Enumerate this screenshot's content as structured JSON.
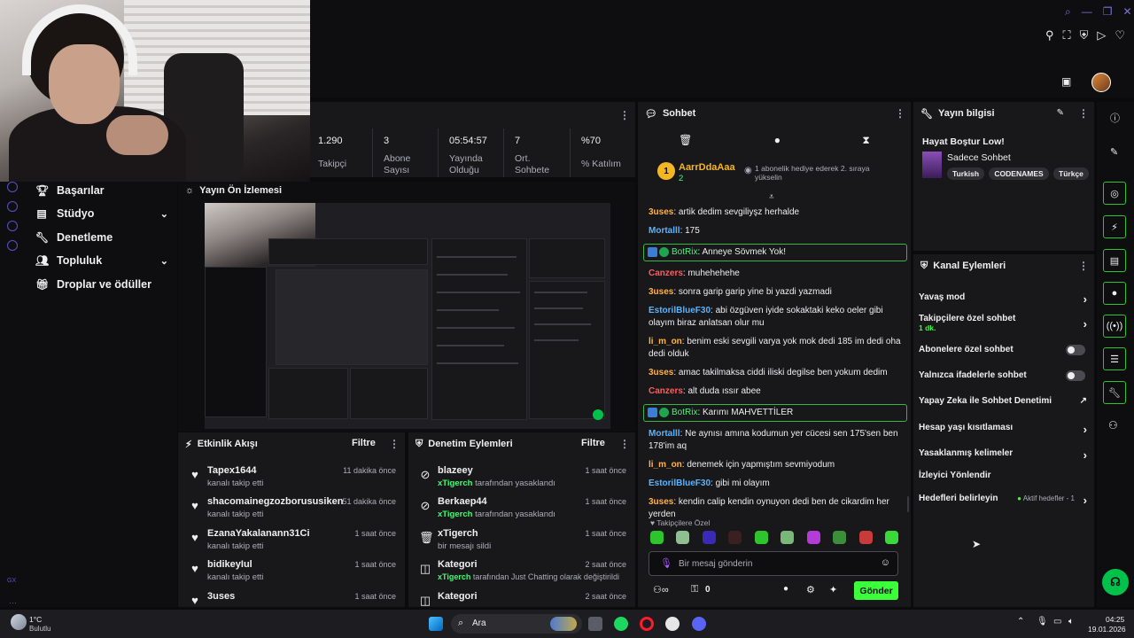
{
  "stats": [
    {
      "value": "1.290",
      "label": "Takipçi"
    },
    {
      "value": "3",
      "label": "Abone Sayısı"
    },
    {
      "value": "05:54:57",
      "label": "Yayında Olduğu"
    },
    {
      "value": "7",
      "label": "Ort. Sohbete"
    },
    {
      "value": "%70",
      "label": "% Katılım"
    }
  ],
  "nav": [
    {
      "label": "Başarılar",
      "icon": "trophy-icon"
    },
    {
      "label": "Stüdyo",
      "icon": "studio-icon"
    },
    {
      "label": "Denetleme",
      "icon": "wrench-icon"
    },
    {
      "label": "Topluluk",
      "icon": "community-icon"
    },
    {
      "label": "Droplar ve ödüller",
      "icon": "gift-icon"
    }
  ],
  "preview": {
    "title": "Yayın Ön İzlemesi"
  },
  "activity": {
    "title": "Etkinlik Akışı",
    "filter": "Filtre",
    "items": [
      {
        "name": "Tapex1644",
        "sub": "kanalı takip etti",
        "time": "11 dakika önce"
      },
      {
        "name": "shacomainegzozborususiken",
        "sub": "kanalı takip etti",
        "time": "51 dakika önce"
      },
      {
        "name": "EzanaYakalanann31Ci",
        "sub": "kanalı takip etti",
        "time": "1 saat önce"
      },
      {
        "name": "bidikeyIul",
        "sub": "kanalı takip etti",
        "time": "1 saat önce"
      },
      {
        "name": "3uses",
        "sub": "",
        "time": "1 saat önce"
      }
    ]
  },
  "modlog": {
    "title": "Denetim Eylemleri",
    "filter": "Filtre",
    "items": [
      {
        "name": "blazeey",
        "actor": "xTigerch",
        "rest": " tarafından yasaklandı",
        "time": "1 saat önce",
        "icon": "ban-icon"
      },
      {
        "name": "Berkaep44",
        "actor": "xTigerch",
        "rest": " tarafından yasaklandı",
        "time": "1 saat önce",
        "icon": "ban-icon"
      },
      {
        "name": "xTigerch",
        "actor": "",
        "rest": "bir mesajı sildi",
        "time": "1 saat önce",
        "icon": "trash-icon"
      },
      {
        "name": "Kategori",
        "actor": "xTigerch",
        "rest": " tarafından Just Chatting olarak değiştirildi",
        "time": "2 saat önce",
        "icon": "category-icon"
      },
      {
        "name": "Kategori",
        "actor": "",
        "rest": "",
        "time": "2 saat önce",
        "icon": "category-icon"
      }
    ]
  },
  "chat": {
    "title": "Sohbet",
    "hype_user": "AarrDdaAaa",
    "hype_rank": "1",
    "hype_count": "2",
    "hype_text": "1 abonelik hediye ederek 2. sıraya yükselin",
    "messages": [
      {
        "user": "3uses",
        "color": "#ffb347",
        "text": "artik dedim sevgiliyşz herhalde"
      },
      {
        "user": "Mortalll",
        "color": "#5ab4ff",
        "text": "175"
      },
      {
        "user": "BotRix",
        "color": "#3bff6f",
        "text": "Anneye Sövmek Yok!",
        "bot": true
      },
      {
        "user": "Canzers",
        "color": "#ff5c5c",
        "text": "muhehehehe"
      },
      {
        "user": "3uses",
        "color": "#ffb347",
        "text": "sonra garip garip yine bi yazdi yazmadi"
      },
      {
        "user": "EstorilBlueF30",
        "color": "#5ab4ff",
        "text": "abi özgüven iyide sokaktaki keko oeler gibi olayım biraz anlatsan olur mu"
      },
      {
        "user": "li_m_on",
        "color": "#ffb347",
        "text": "benim eski sevgili varya yok mok dedi 185 im dedi oha dedi olduk"
      },
      {
        "user": "3uses",
        "color": "#ffb347",
        "text": "amac takilmaksa ciddi iliski degilse ben yokum dedim"
      },
      {
        "user": "Canzers",
        "color": "#ff5c5c",
        "text": "alt duda ıssır abee"
      },
      {
        "user": "BotRix",
        "color": "#3bff6f",
        "text": "Karımı MAHVETTİLER",
        "bot": true
      },
      {
        "user": "Mortalll",
        "color": "#5ab4ff",
        "text": "Ne aynısı amına kodumun yer cücesi sen 175'sen ben 178'im aq"
      },
      {
        "user": "li_m_on",
        "color": "#ffb347",
        "text": "denemek için yapmıştım sevmiyodum"
      },
      {
        "user": "EstorilBlueF30",
        "color": "#5ab4ff",
        "text": "gibi mi olayım"
      },
      {
        "user": "3uses",
        "color": "#ffb347",
        "text": "kendin calip kendin oynuyon dedi ben de cikardim her yerden"
      }
    ],
    "emote_label": "Takipçilere Özel",
    "placeholder": "Bir mesaj gönderin",
    "points": "0",
    "send": "Gönder"
  },
  "info": {
    "title": "Yayın bilgisi",
    "stream_title": "Hayat Boştur Low!",
    "category": "Sadece Sohbet",
    "tags": [
      "Turkish",
      "CODENAMES",
      "Türkçe"
    ]
  },
  "actions": {
    "title": "Kanal Eylemleri",
    "items": [
      {
        "label": "Yavaş mod",
        "kind": "chev"
      },
      {
        "label": "Takipçilere özel sohbet",
        "sub": "1 dk.",
        "kind": "chev"
      },
      {
        "label": "Abonelere özel sohbet",
        "kind": "toggle"
      },
      {
        "label": "Yalnızca ifadelerle sohbet",
        "kind": "toggle"
      },
      {
        "label": "Yapay Zeka ile Sohbet Denetimi",
        "kind": "ext"
      },
      {
        "label": "Hesap yaşı kısıtlaması",
        "kind": "chev"
      },
      {
        "label": "Yasaklanmış kelimeler",
        "kind": "chev"
      },
      {
        "label": "İzleyici Yönlendir",
        "kind": "none"
      },
      {
        "label": "Hedefleri belirleyin",
        "status": "Aktif hedefler - 1",
        "kind": "chev"
      }
    ]
  },
  "taskbar": {
    "weather_temp": "1°C",
    "weather_desc": "Bulutlu",
    "search": "Ara",
    "time": "04:25",
    "date": "19.01.2026"
  },
  "colors": {
    "accent": "#3bff3b",
    "purple": "#7a72d8",
    "panel": "#18181b"
  }
}
